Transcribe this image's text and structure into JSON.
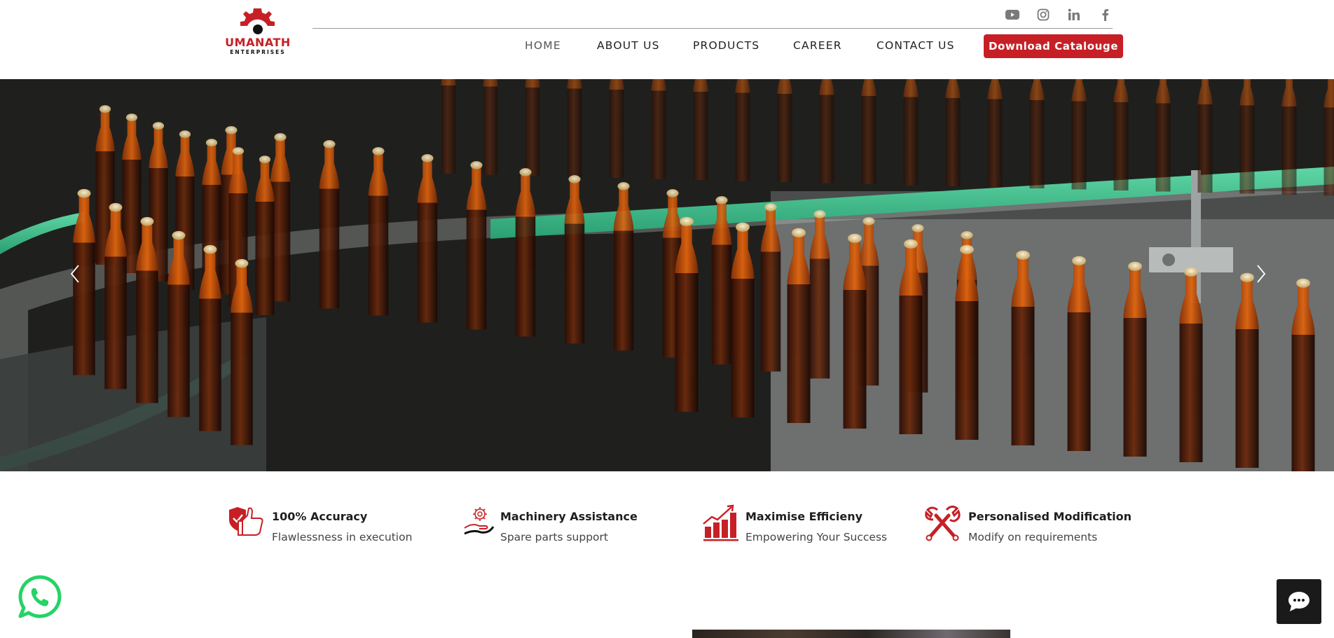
{
  "brand": {
    "name": "UMANATH",
    "tagline": "ENTERPRISES",
    "color": "#c62026"
  },
  "socials": [
    {
      "icon": "youtube-icon"
    },
    {
      "icon": "instagram-icon"
    },
    {
      "icon": "linkedin-icon"
    },
    {
      "icon": "facebook-icon"
    }
  ],
  "nav": {
    "home": "HOME",
    "about": "ABOUT US",
    "products": "PRODUCTS",
    "career": "CAREER",
    "contact": "CONTACT US",
    "active": "HOME"
  },
  "download_button": "Download Catalouge",
  "hero": {
    "image": "amber glass bottles on a conveyor line",
    "prev_icon": "chevron-left-icon",
    "next_icon": "chevron-right-icon"
  },
  "features": [
    {
      "icon": "thumbs-up-shield-icon",
      "title": "100% Accuracy",
      "subtitle": "Flawlessness in execution"
    },
    {
      "icon": "gear-hand-icon",
      "title": "Machinery Assistance",
      "subtitle": "Spare parts support"
    },
    {
      "icon": "growth-chart-icon",
      "title": "Maximise Efficieny",
      "subtitle": "Empowering Your Success"
    },
    {
      "icon": "wrench-tools-icon",
      "title": "Personalised Modification",
      "subtitle": "Modify on requirements"
    }
  ],
  "floating": {
    "whatsapp_icon": "whatsapp-icon",
    "chat_icon": "chat-icon",
    "whatsapp_color": "#25d366"
  }
}
